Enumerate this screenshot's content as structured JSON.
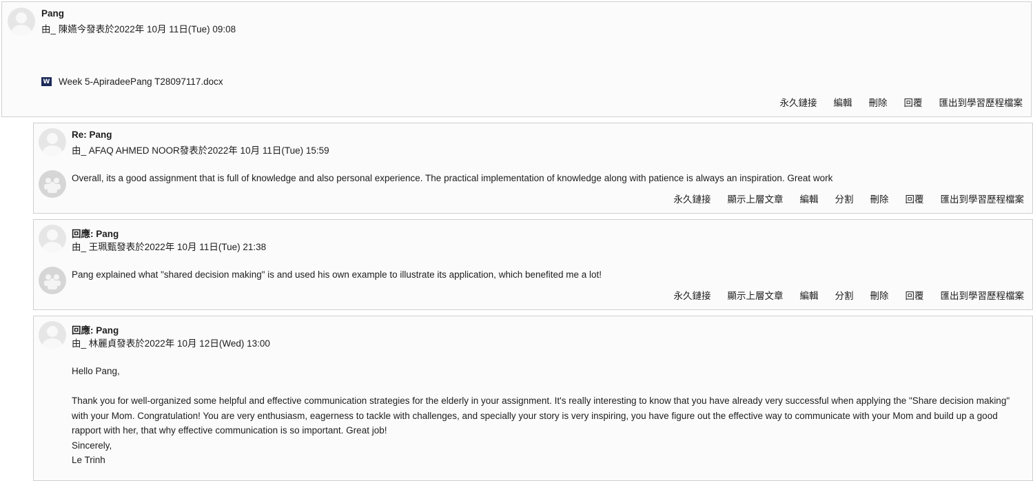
{
  "posts": [
    {
      "subject": "Pang",
      "byline": "由_ 陳嬿今發表於2022年 10月 11日(Tue) 09:08",
      "attachment": "Week 5-ApiradeePang T28097117.docx",
      "attachment_icon": "word-doc-icon",
      "commands": [
        "永久鏈接",
        "編輯",
        "刪除",
        "回覆",
        "匯出到學習歷程檔案"
      ]
    },
    {
      "subject": "Re: Pang",
      "byline": "由_ AFAQ AHMED NOOR發表於2022年 10月 11日(Tue) 15:59",
      "content": "Overall, its a good assignment that is full of knowledge and also personal experience. The practical implementation of knowledge along with patience is always an inspiration. Great work",
      "commands": [
        "永久鏈接",
        "顯示上層文章",
        "編輯",
        "分割",
        "刪除",
        "回覆",
        "匯出到學習歷程檔案"
      ]
    },
    {
      "subject": "回應: Pang",
      "byline": "由_ 王珮甄發表於2022年 10月 11日(Tue) 21:38",
      "content": "Pang explained what \"shared decision making\" is and used his own example to illustrate its application, which benefited me a lot!",
      "commands": [
        "永久鏈接",
        "顯示上層文章",
        "編輯",
        "分割",
        "刪除",
        "回覆",
        "匯出到學習歷程檔案"
      ]
    },
    {
      "subject": "回應: Pang",
      "byline": "由_ 林麗貞發表於2022年 10月 12日(Wed) 13:00",
      "greeting": "Hello Pang,",
      "body": "Thank you for well-organized some helpful and effective communication strategies for the elderly in your assignment. It's really interesting to know that you have already very successful when applying the \"Share decision making\" with your Mom. Congratulation! You are very enthusiasm, eagerness to tackle with challenges, and specially your story is very inspiring, you have figure out the effective way to communicate with your Mom and build up a good rapport with her, that why effective communication is so important. Great job!",
      "closing": "Sincerely,",
      "signature": "Le Trinh"
    }
  ]
}
